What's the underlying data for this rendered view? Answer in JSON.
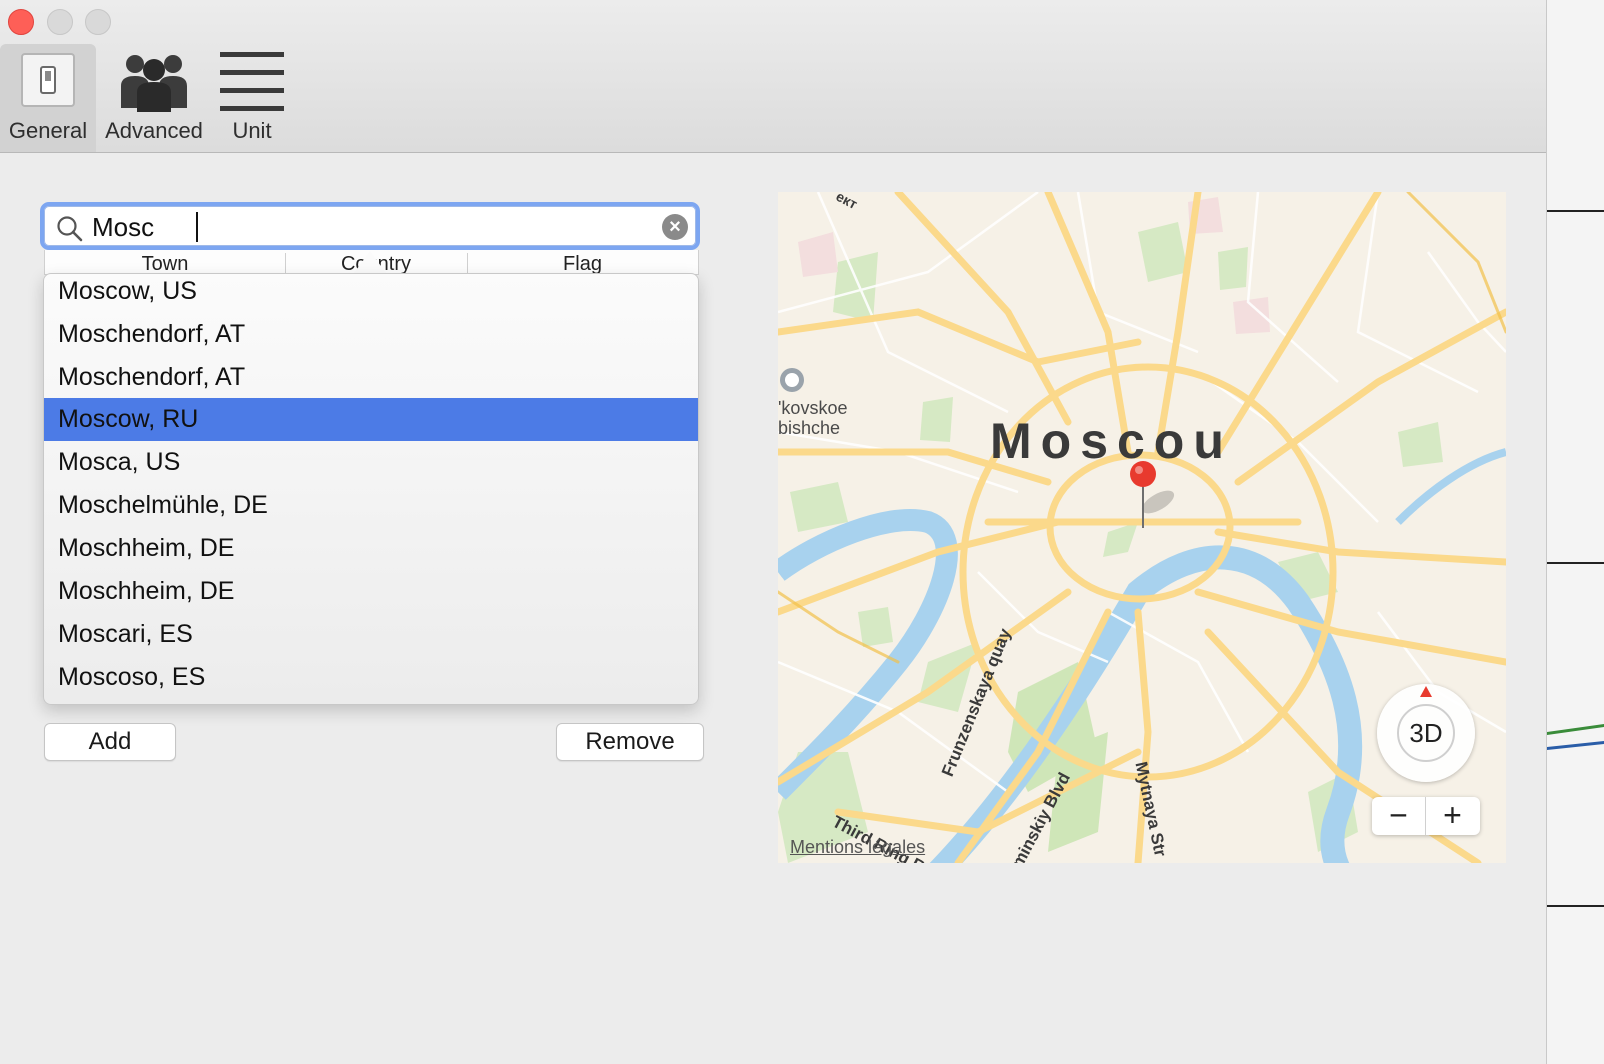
{
  "window": {
    "controls": [
      "close",
      "minimize",
      "zoom"
    ]
  },
  "toolbar": {
    "items": [
      {
        "label": "General",
        "icon": "switch-icon",
        "active": true
      },
      {
        "label": "Advanced",
        "icon": "users-icon",
        "active": false
      },
      {
        "label": "Unit",
        "icon": "lines-icon",
        "active": false
      }
    ]
  },
  "search": {
    "value": "Mosc",
    "icon": "magnifier-icon",
    "clear_icon": "clear-circle-icon"
  },
  "table": {
    "columns": [
      "Town",
      "Country",
      "Flag"
    ]
  },
  "results": {
    "items": [
      "Moscow, US",
      "Moschendorf, AT",
      "Moschendorf, AT",
      "Moscow, RU",
      "Mosca, US",
      "Moschelmühle, DE",
      "Moschheim, DE",
      "Moschheim, DE",
      "Moscari, ES",
      "Moscoso, ES"
    ],
    "selected_index": 3,
    "selection_color": "#4c7be6"
  },
  "buttons": {
    "add": "Add",
    "remove": "Remove"
  },
  "map": {
    "city_label": "Moscou",
    "poi_label_line1": "'kovskoe",
    "poi_label_line2": "bishche",
    "top_fragment": "ект",
    "streets": [
      "Frunzenskaya quay",
      "minskiy Blvd",
      "Mytnaya Str",
      "Third Ring R"
    ],
    "legal": "Mentions légales",
    "compass_label": "3D",
    "zoom_out": "−",
    "zoom_in": "+",
    "pin_color": "#e83a2e"
  }
}
